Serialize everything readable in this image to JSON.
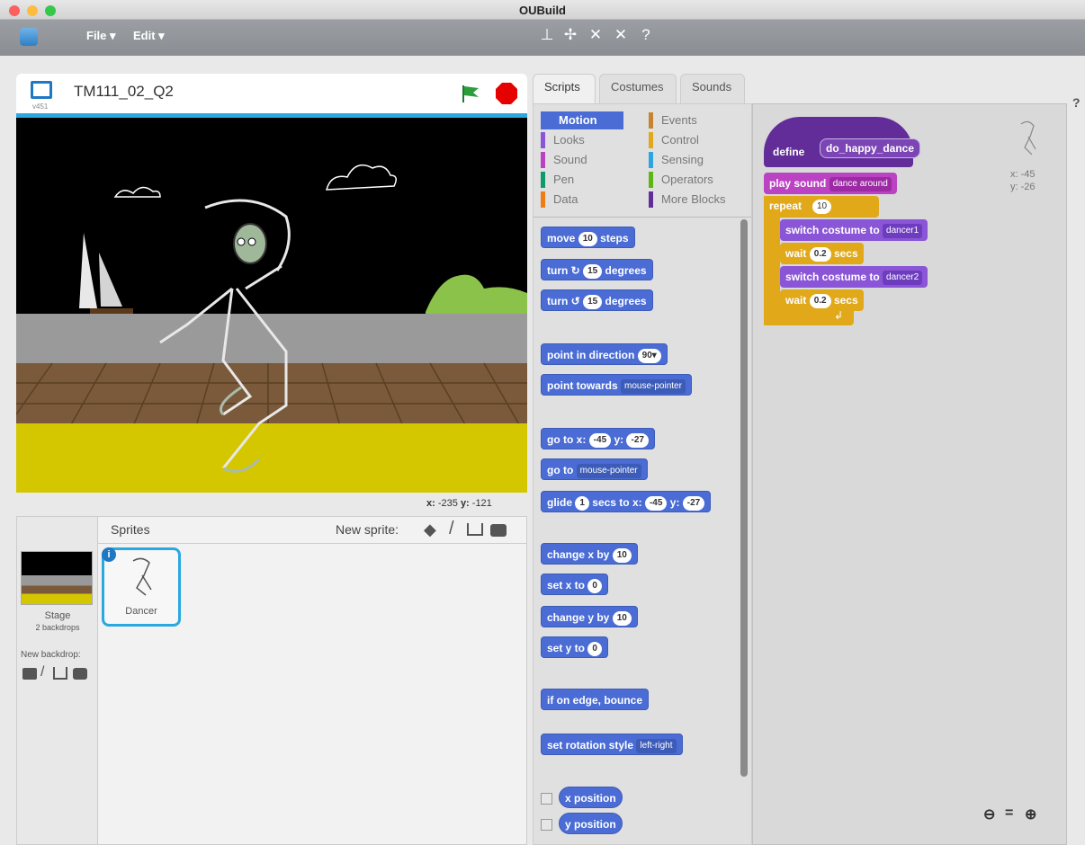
{
  "window": {
    "title": "OUBuild"
  },
  "menu": {
    "file": "File ▾",
    "edit": "Edit ▾"
  },
  "toolbar": {
    "icons": [
      "stamp-icon",
      "move-icon",
      "grow-icon",
      "shrink-icon",
      "help-icon"
    ]
  },
  "stage": {
    "project_name": "TM111_02_Q2",
    "version": "v451",
    "coords": {
      "x_label": "x:",
      "x": "-235",
      "y_label": "y:",
      "y": "-121"
    }
  },
  "sprites": {
    "header": "Sprites",
    "new_sprite_label": "New sprite:",
    "stage_label": "Stage",
    "stage_backdrops": "2 backdrops",
    "new_backdrop_label": "New backdrop:",
    "items": [
      {
        "name": "Dancer"
      }
    ]
  },
  "tabs": [
    "Scripts",
    "Costumes",
    "Sounds"
  ],
  "categories": [
    {
      "label": "Motion",
      "color": "#4a6cd4"
    },
    {
      "label": "Events",
      "color": "#c88330"
    },
    {
      "label": "Looks",
      "color": "#8a55d7"
    },
    {
      "label": "Control",
      "color": "#e1a91a"
    },
    {
      "label": "Sound",
      "color": "#bb42c3"
    },
    {
      "label": "Sensing",
      "color": "#2ca5e2"
    },
    {
      "label": "Pen",
      "color": "#0e9a6c"
    },
    {
      "label": "Operators",
      "color": "#5cb712"
    },
    {
      "label": "Data",
      "color": "#ee7d16"
    },
    {
      "label": "More Blocks",
      "color": "#632d99"
    }
  ],
  "palette": {
    "move": {
      "pre": "move",
      "val": "10",
      "post": "steps"
    },
    "turn_right": {
      "pre": "turn",
      "val": "15",
      "post": "degrees"
    },
    "turn_left": {
      "pre": "turn",
      "val": "15",
      "post": "degrees"
    },
    "point_dir": {
      "pre": "point in direction",
      "val": "90▾"
    },
    "point_towards": {
      "pre": "point towards",
      "drop": "mouse-pointer"
    },
    "goto_xy": {
      "pre": "go to x:",
      "x": "-45",
      "mid": "y:",
      "y": "-27"
    },
    "goto": {
      "pre": "go to",
      "drop": "mouse-pointer"
    },
    "glide": {
      "pre": "glide",
      "secs": "1",
      "mid": "secs to x:",
      "x": "-45",
      "ylabel": "y:",
      "y": "-27"
    },
    "change_x": {
      "pre": "change x by",
      "val": "10"
    },
    "set_x": {
      "pre": "set x to",
      "val": "0"
    },
    "change_y": {
      "pre": "change y by",
      "val": "10"
    },
    "set_y": {
      "pre": "set y to",
      "val": "0"
    },
    "bounce": "if on edge, bounce",
    "rotation": {
      "pre": "set rotation style",
      "drop": "left-right"
    },
    "x_position": "x position",
    "y_position": "y position"
  },
  "script": {
    "define": {
      "pre": "define",
      "name": "do_happy_dance"
    },
    "play_sound": {
      "pre": "play sound",
      "drop": "dance around"
    },
    "repeat": {
      "pre": "repeat",
      "val": "10"
    },
    "switch1": {
      "pre": "switch costume to",
      "drop": "dancer1"
    },
    "wait1": {
      "pre": "wait",
      "val": "0.2",
      "post": "secs"
    },
    "switch2": {
      "pre": "switch costume to",
      "drop": "dancer2"
    },
    "wait2": {
      "pre": "wait",
      "val": "0.2",
      "post": "secs"
    },
    "sprite_coords": {
      "x": "x: -45",
      "y": "y: -26"
    }
  },
  "colors": {
    "motion": "#4a6cd4",
    "looks": "#8a55d7",
    "sound": "#bb42c3",
    "control": "#e1a91a",
    "more": "#632d99",
    "stage_accent": "#29a9e0"
  }
}
